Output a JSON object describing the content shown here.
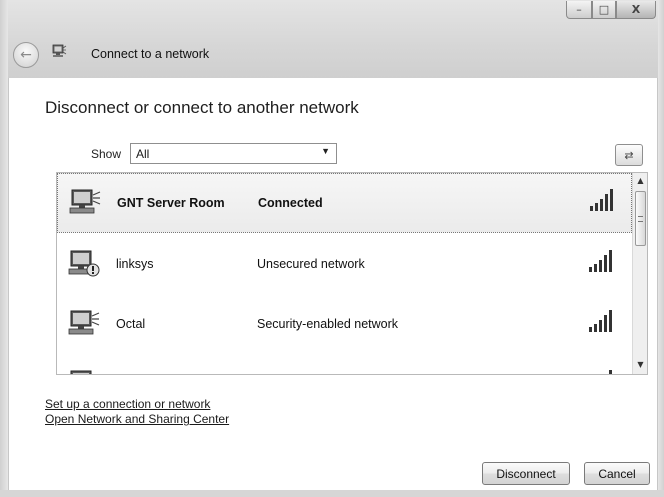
{
  "window": {
    "title": "Connect to a network",
    "controls": {
      "minimize": "–",
      "maximize": "□",
      "close": "X"
    }
  },
  "heading": "Disconnect or connect to another network",
  "filter": {
    "label": "Show",
    "selected": "All"
  },
  "networks": [
    {
      "name": "GNT Server Room",
      "status": "Connected",
      "selected": true,
      "signal_bars": 5
    },
    {
      "name": "linksys",
      "status": "Unsecured network",
      "selected": false,
      "signal_bars": 5
    },
    {
      "name": "Octal",
      "status": "Security-enabled network",
      "selected": false,
      "signal_bars": 5
    },
    {
      "name": "",
      "status": "",
      "selected": false,
      "signal_bars": 2
    }
  ],
  "links": {
    "setup": "Set up a connection or network",
    "sharing_center": "Open Network and Sharing Center"
  },
  "buttons": {
    "disconnect": "Disconnect",
    "cancel": "Cancel"
  },
  "icons": {
    "back": "back-arrow-icon",
    "network": "network-icon",
    "refresh": "refresh-icon",
    "signal": "signal-strength-icon"
  }
}
